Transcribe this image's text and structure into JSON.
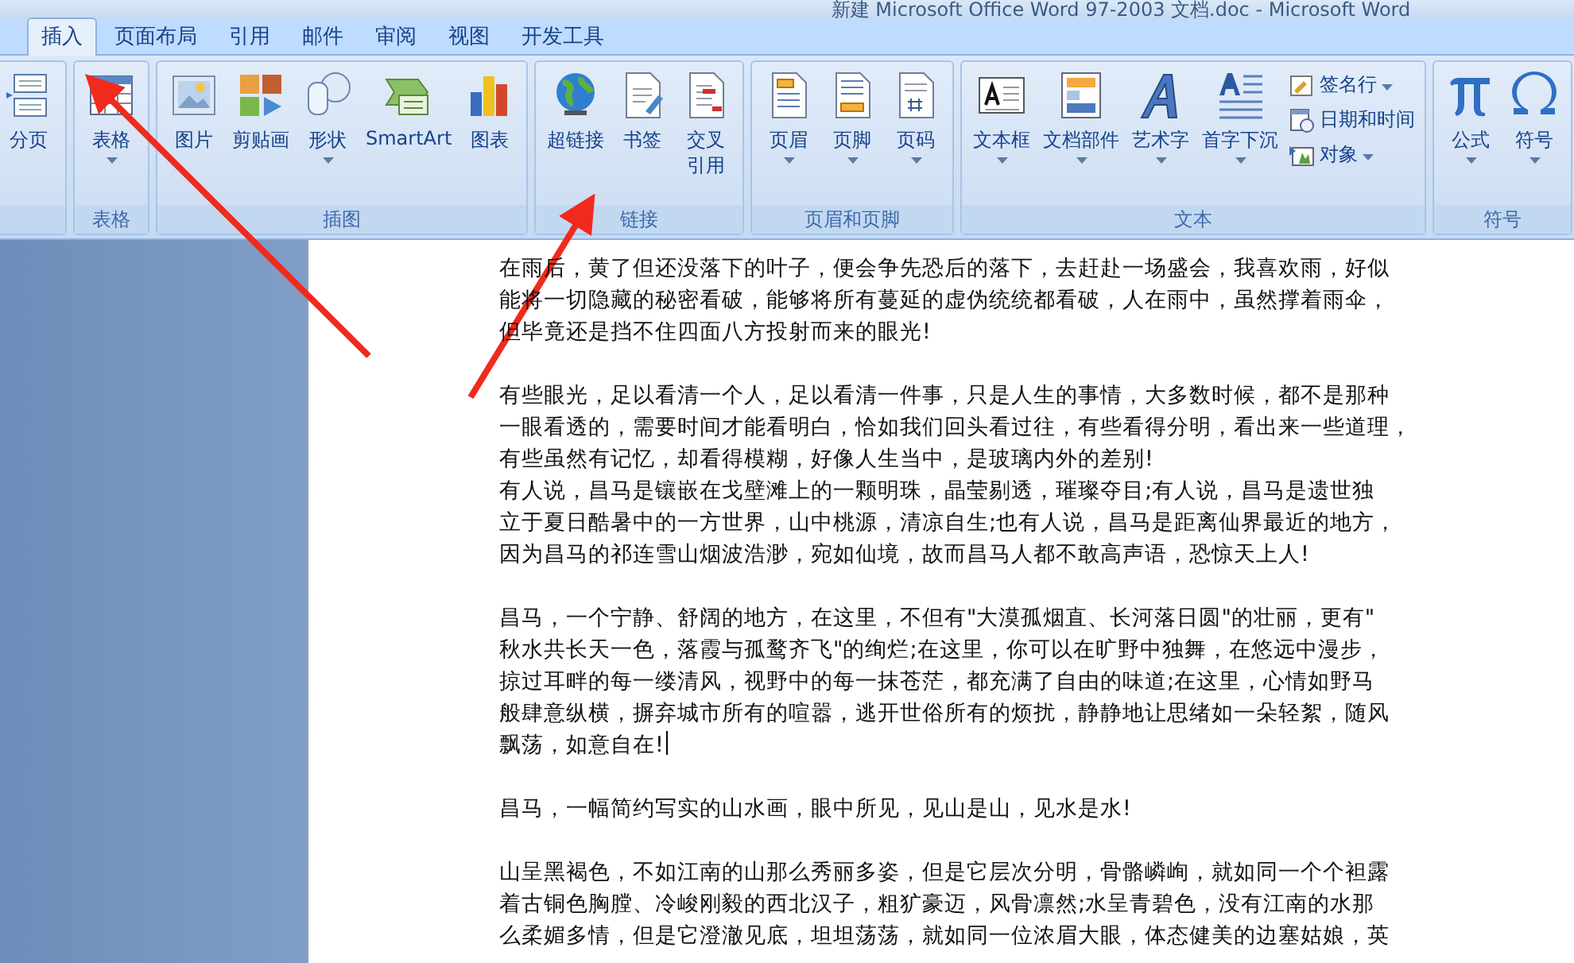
{
  "window": {
    "title": "新建 Microsoft Office Word 97-2003 文档.doc - Microsoft Word"
  },
  "tabs": [
    {
      "label": "插入",
      "selected": true
    },
    {
      "label": "页面布局",
      "selected": false
    },
    {
      "label": "引用",
      "selected": false
    },
    {
      "label": "邮件",
      "selected": false
    },
    {
      "label": "审阅",
      "selected": false
    },
    {
      "label": "视图",
      "selected": false
    },
    {
      "label": "开发工具",
      "selected": false
    }
  ],
  "ribbon": {
    "groups": [
      {
        "items": [
          {
            "kind": "large",
            "label": "分页",
            "dropdown": false
          }
        ]
      },
      {
        "label": "表格",
        "items": [
          {
            "kind": "large",
            "label": "表格",
            "dropdown": true
          }
        ]
      },
      {
        "label": "插图",
        "items": [
          {
            "kind": "large",
            "label": "图片",
            "dropdown": false
          },
          {
            "kind": "large",
            "label": "剪贴画",
            "dropdown": false
          },
          {
            "kind": "large",
            "label": "形状",
            "dropdown": true
          },
          {
            "kind": "large",
            "label": "SmartArt",
            "dropdown": false
          },
          {
            "kind": "large",
            "label": "图表",
            "dropdown": false
          }
        ]
      },
      {
        "label": "链接",
        "items": [
          {
            "kind": "large",
            "label": "超链接",
            "dropdown": false
          },
          {
            "kind": "large",
            "label": "书签",
            "dropdown": false
          },
          {
            "kind": "large",
            "label": "交叉引用",
            "dropdown": false
          }
        ]
      },
      {
        "label": "页眉和页脚",
        "items": [
          {
            "kind": "large",
            "label": "页眉",
            "dropdown": true
          },
          {
            "kind": "large",
            "label": "页脚",
            "dropdown": true
          },
          {
            "kind": "large",
            "label": "页码",
            "dropdown": true
          }
        ]
      },
      {
        "label": "文本",
        "items": [
          {
            "kind": "large",
            "label": "文本框",
            "dropdown": true
          },
          {
            "kind": "large",
            "label": "文档部件",
            "dropdown": true
          },
          {
            "kind": "large",
            "label": "艺术字",
            "dropdown": true
          },
          {
            "kind": "large",
            "label": "首字下沉",
            "dropdown": true
          },
          {
            "kind": "small",
            "label": "签名行",
            "dropdown": true
          },
          {
            "kind": "small",
            "label": "日期和时间",
            "dropdown": false
          },
          {
            "kind": "small",
            "label": "对象",
            "dropdown": true
          }
        ]
      },
      {
        "label": "符号",
        "items": [
          {
            "kind": "large",
            "label": "公式",
            "dropdown": true
          },
          {
            "kind": "large",
            "label": "符号",
            "dropdown": true
          }
        ]
      }
    ]
  },
  "document": {
    "sections": [
      {
        "paragraphs": [
          {
            "lines": [
              "在雨后，黄了但还没落下的叶子，便会争先恐后的落下，去赶赴一场盛会，我喜欢雨，好似",
              "能将一切隐藏的秘密看破，能够将所有蔓延的虚伪统统都看破，人在雨中，虽然撑着雨伞，",
              "但毕竟还是挡不住四面八方投射而来的眼光!"
            ]
          }
        ]
      },
      {
        "paragraphs": [
          {
            "lines": [
              "有些眼光，足以看清一个人，足以看清一件事，只是人生的事情，大多数时候，都不是那种",
              "一眼看透的，需要时间才能看明白，恰如我们回头看过往，有些看得分明，看出来一些道理，",
              "有些虽然有记忆，却看得模糊，好像人生当中，是玻璃内外的差别!"
            ]
          },
          {
            "lines": [
              "有人说，昌马是镶嵌在戈壁滩上的一颗明珠，晶莹剔透，璀璨夺目;有人说，昌马是遗世独",
              "立于夏日酷暑中的一方世界，山中桃源，清凉自生;也有人说，昌马是距离仙界最近的地方，",
              "因为昌马的祁连雪山烟波浩渺，宛如仙境，故而昌马人都不敢高声语，恐惊天上人!"
            ]
          }
        ]
      },
      {
        "paragraphs": [
          {
            "caret": true,
            "lines": [
              "昌马，一个宁静、舒阔的地方，在这里，不但有\"大漠孤烟直、长河落日圆\"的壮丽，更有\"",
              "秋水共长天一色，落霞与孤鹜齐飞\"的绚烂;在这里，你可以在旷野中独舞，在悠远中漫步，",
              "掠过耳畔的每一缕清风，视野中的每一抹苍茫，都充满了自由的味道;在这里，心情如野马",
              "般肆意纵横，摒弃城市所有的喧嚣，逃开世俗所有的烦扰，静静地让思绪如一朵轻絮，随风",
              "飘荡，如意自在!"
            ]
          }
        ]
      },
      {
        "paragraphs": [
          {
            "lines": [
              "昌马，一幅简约写实的山水画，眼中所见，见山是山，见水是水!"
            ]
          }
        ]
      },
      {
        "paragraphs": [
          {
            "lines": [
              "山呈黑褐色，不如江南的山那么秀丽多姿，但是它层次分明，骨骼嶙峋，就如同一个个袒露",
              "着古铜色胸膛、冷峻刚毅的西北汉子，粗犷豪迈，风骨凛然;水呈青碧色，没有江南的水那",
              "么柔媚多情，但是它澄澈见底，坦坦荡荡，就如同一位浓眉大眼，体态健美的边塞姑娘，英"
            ]
          }
        ]
      }
    ]
  }
}
